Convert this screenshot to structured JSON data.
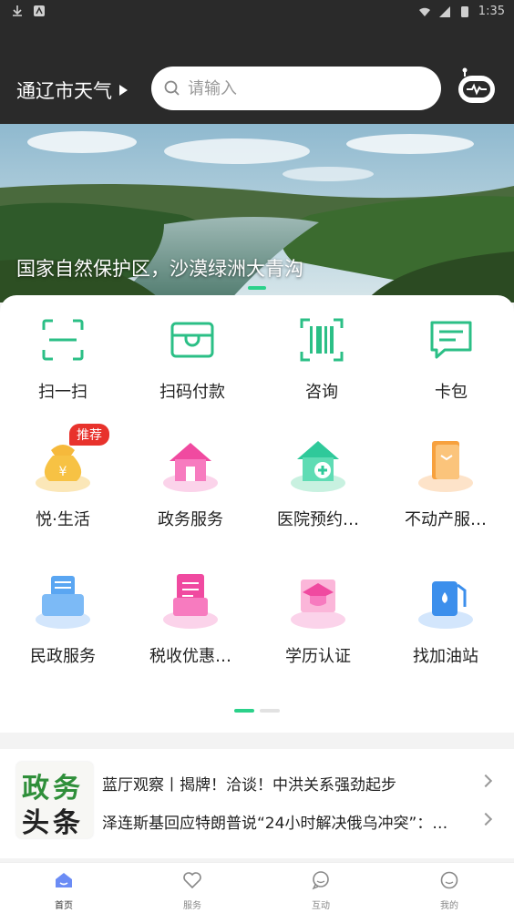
{
  "status_bar": {
    "time": "1:35"
  },
  "header": {
    "weather_label": "通辽市天气",
    "search_placeholder": "请输入"
  },
  "banner": {
    "caption": "国家自然保护区，沙漠绿洲大青沟"
  },
  "quick_actions": [
    {
      "label": "扫一扫",
      "icon": "scan-icon"
    },
    {
      "label": "扫码付款",
      "icon": "wallet-icon"
    },
    {
      "label": "咨询",
      "icon": "barcode-scan-icon"
    },
    {
      "label": "卡包",
      "icon": "message-card-icon"
    }
  ],
  "services": [
    {
      "label": "悦·生活",
      "icon": "money-bag-icon",
      "badge": "推荐"
    },
    {
      "label": "政务服务",
      "icon": "government-house-icon"
    },
    {
      "label": "医院预约…",
      "icon": "hospital-icon"
    },
    {
      "label": "不动产服…",
      "icon": "real-estate-icon"
    },
    {
      "label": "民政服务",
      "icon": "civil-affairs-icon"
    },
    {
      "label": "税收优惠…",
      "icon": "tax-document-icon"
    },
    {
      "label": "学历认证",
      "icon": "graduation-cap-icon"
    },
    {
      "label": "找加油站",
      "icon": "gas-station-icon"
    }
  ],
  "news": {
    "logo_line1": "政务",
    "logo_line2": "头条",
    "items": [
      "蓝厅观察丨揭牌！洽谈！中洪关系强劲起步",
      "泽连斯基回应特朗普说“24小时解决俄乌冲突”：…"
    ]
  },
  "tabbar": [
    {
      "label": "首页",
      "icon": "home-icon",
      "active": true
    },
    {
      "label": "服务",
      "icon": "heart-icon",
      "active": false
    },
    {
      "label": "互动",
      "icon": "chat-bubble-icon",
      "active": false
    },
    {
      "label": "我的",
      "icon": "smiley-icon",
      "active": false
    }
  ],
  "colors": {
    "accent_green": "#2bd18a",
    "badge_red": "#e8322c",
    "header_bg": "#2a2a2a"
  }
}
